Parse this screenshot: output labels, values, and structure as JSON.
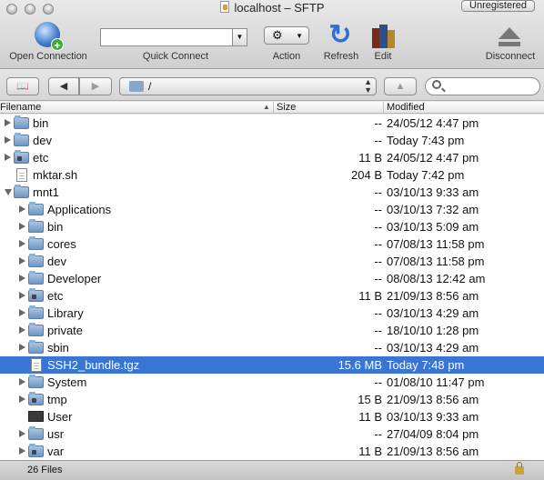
{
  "window": {
    "title": "localhost – SFTP",
    "badge": "Unregistered"
  },
  "toolbar": {
    "open_connection": "Open Connection",
    "quick_connect": "Quick Connect",
    "action": "Action",
    "refresh": "Refresh",
    "edit": "Edit",
    "disconnect": "Disconnect"
  },
  "pathbar": {
    "path": "/",
    "back_glyph": "◀",
    "forward_glyph": "▶",
    "up_glyph": "▲",
    "search_value": ""
  },
  "columns": {
    "filename": "Filename",
    "size": "Size",
    "modified": "Modified"
  },
  "rows": [
    {
      "name": "bin",
      "size": "--",
      "modified": "24/05/12 4:47 pm",
      "icon": "folder-icon",
      "depth": 0,
      "disclosure": "closed"
    },
    {
      "name": "dev",
      "size": "--",
      "modified": "Today 7:43 pm",
      "icon": "folder-icon",
      "depth": 0,
      "disclosure": "closed"
    },
    {
      "name": "etc",
      "size": "11 B",
      "modified": "24/05/12 4:47 pm",
      "icon": "alias-folder-icon",
      "depth": 0,
      "disclosure": "closed"
    },
    {
      "name": "mktar.sh",
      "size": "204 B",
      "modified": "Today 7:42 pm",
      "icon": "file-icon",
      "depth": 0,
      "disclosure": "none"
    },
    {
      "name": "mnt1",
      "size": "--",
      "modified": "03/10/13 9:33 am",
      "icon": "folder-icon",
      "depth": 0,
      "disclosure": "open"
    },
    {
      "name": "Applications",
      "size": "--",
      "modified": "03/10/13 7:32 am",
      "icon": "folder-icon",
      "depth": 1,
      "disclosure": "closed"
    },
    {
      "name": "bin",
      "size": "--",
      "modified": "03/10/13 5:09 am",
      "icon": "folder-icon",
      "depth": 1,
      "disclosure": "closed"
    },
    {
      "name": "cores",
      "size": "--",
      "modified": "07/08/13 11:58 pm",
      "icon": "folder-icon",
      "depth": 1,
      "disclosure": "closed"
    },
    {
      "name": "dev",
      "size": "--",
      "modified": "07/08/13 11:58 pm",
      "icon": "folder-icon",
      "depth": 1,
      "disclosure": "closed"
    },
    {
      "name": "Developer",
      "size": "--",
      "modified": "08/08/13 12:42 am",
      "icon": "folder-icon",
      "depth": 1,
      "disclosure": "closed"
    },
    {
      "name": "etc",
      "size": "11 B",
      "modified": "21/09/13 8:56 am",
      "icon": "alias-folder-icon",
      "depth": 1,
      "disclosure": "closed"
    },
    {
      "name": "Library",
      "size": "--",
      "modified": "03/10/13 4:29 am",
      "icon": "folder-icon",
      "depth": 1,
      "disclosure": "closed"
    },
    {
      "name": "private",
      "size": "--",
      "modified": "18/10/10 1:28 pm",
      "icon": "folder-icon",
      "depth": 1,
      "disclosure": "closed"
    },
    {
      "name": "sbin",
      "size": "--",
      "modified": "03/10/13 4:29 am",
      "icon": "folder-icon",
      "depth": 1,
      "disclosure": "closed"
    },
    {
      "name": "SSH2_bundle.tgz",
      "size": "15.6 MB",
      "modified": "Today 7:48 pm",
      "icon": "file-icon",
      "depth": 1,
      "disclosure": "none",
      "selected": true
    },
    {
      "name": "System",
      "size": "--",
      "modified": "01/08/10 11:47 pm",
      "icon": "folder-icon",
      "depth": 1,
      "disclosure": "closed"
    },
    {
      "name": "tmp",
      "size": "15 B",
      "modified": "21/09/13 8:56 am",
      "icon": "alias-folder-icon",
      "depth": 1,
      "disclosure": "closed"
    },
    {
      "name": "User",
      "size": "11 B",
      "modified": "03/10/13 9:33 am",
      "icon": "terminal-icon",
      "depth": 1,
      "disclosure": "none"
    },
    {
      "name": "usr",
      "size": "--",
      "modified": "27/04/09 8:04 pm",
      "icon": "folder-icon",
      "depth": 1,
      "disclosure": "closed"
    },
    {
      "name": "var",
      "size": "11 B",
      "modified": "21/09/13 8:56 am",
      "icon": "alias-folder-icon",
      "depth": 1,
      "disclosure": "closed"
    }
  ],
  "status": {
    "count": "26 Files"
  },
  "colors": {
    "selection": "#3875d7",
    "folder": "#6f95c2"
  }
}
